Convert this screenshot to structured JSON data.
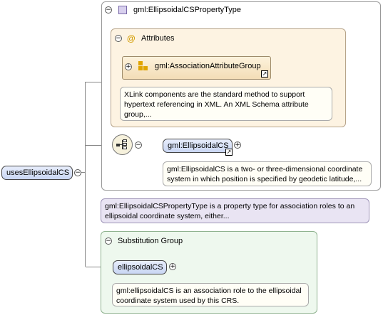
{
  "complex_type": {
    "name": "gml:EllipsoidalCSPropertyType",
    "documentation": "gml:EllipsoidalCSPropertyType is a property type for association roles to an ellipsoidal coordinate system, either..."
  },
  "attributes": {
    "title": "Attributes",
    "group_name": "gml:AssociationAttributeGroup",
    "group_documentation": "XLink components are the standard method to support hypertext referencing in XML. An XML Schema attribute group,..."
  },
  "sequence_element": {
    "name": "gml:EllipsoidalCS",
    "documentation": "gml:EllipsoidalCS is a two- or three-dimensional coordinate system in which position is specified by geodetic latitude,..."
  },
  "root_element": {
    "name": "usesEllipsoidalCS"
  },
  "substitution_group": {
    "title": "Substitution Group",
    "element_name": "ellipsoidalCS",
    "documentation": "gml:ellipsoidalCS is an association role to the ellipsoidal coordinate system used by this CRS."
  },
  "glyphs": {
    "collapse": "−",
    "expand": "+",
    "shortcut": "↗",
    "attribute_at": "@"
  },
  "colors": {
    "attributes_bg": "#fdf3e2",
    "substitution_bg": "#eef8ee",
    "doc_purple_bg": "#e9e4f3",
    "element_pill": "#c9d6f3"
  }
}
